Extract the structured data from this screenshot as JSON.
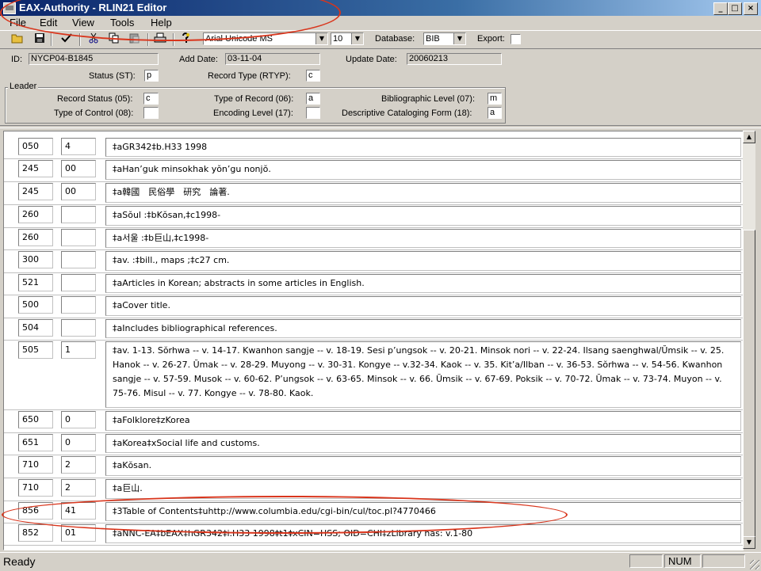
{
  "window": {
    "title": "EAX-Authority - RLIN21 Editor",
    "min_glyph": "_",
    "max_glyph": "□",
    "close_glyph": "×"
  },
  "menu": [
    "File",
    "Edit",
    "View",
    "Tools",
    "Help"
  ],
  "toolbar": {
    "icons": [
      "open-folder-icon",
      "save-icon",
      "checkmark-icon",
      "cut-icon",
      "copy-icon",
      "paste-icon",
      "print-icon",
      "help-icon"
    ],
    "font": "Arial Unicode MS",
    "font_size": "10",
    "database_label": "Database:",
    "database": "BIB",
    "export_label": "Export:",
    "export_checked": false
  },
  "header": {
    "id_label": "ID:",
    "id": "NYCP04-B1845",
    "add_date_label": "Add Date:",
    "add_date": "03-11-04",
    "update_date_label": "Update Date:",
    "update_date": "20060213",
    "status_label": "Status (ST):",
    "status": "p",
    "record_type_label": "Record Type (RTYP):",
    "record_type": "c"
  },
  "leader": {
    "group_label": "Leader",
    "record_status_label": "Record Status (05):",
    "record_status": "c",
    "type_of_record_label": "Type of Record (06):",
    "type_of_record": "a",
    "bib_level_label": "Bibliographic Level (07):",
    "bib_level": "m",
    "type_of_control_label": "Type of Control (08):",
    "type_of_control": "",
    "encoding_level_label": "Encoding Level (17):",
    "encoding_level": "",
    "desc_form_label": "Descriptive Cataloging Form (18):",
    "desc_form": "a"
  },
  "fields": [
    {
      "tag": "050",
      "ind": "4",
      "data": "‡aGR342‡b.H33 1998"
    },
    {
      "tag": "245",
      "ind": "00",
      "data": "‡aHan’guk minsokhak yŏn’gu nonjŏ."
    },
    {
      "tag": "245",
      "ind": "00",
      "data": "‡a韓國　民俗學　研究　論著."
    },
    {
      "tag": "260",
      "ind": "",
      "data": "‡aSŏul :‡bKŏsan,‡c1998-"
    },
    {
      "tag": "260",
      "ind": "",
      "data": "‡a서울 :‡b巨山,‡c1998-"
    },
    {
      "tag": "300",
      "ind": "",
      "data": "‡av. :‡bill., maps ;‡c27 cm."
    },
    {
      "tag": "521",
      "ind": "",
      "data": "‡aArticles in Korean; abstracts in some articles in English."
    },
    {
      "tag": "500",
      "ind": "",
      "data": "‡aCover title."
    },
    {
      "tag": "504",
      "ind": "",
      "data": "‡aIncludes bibliographical references."
    },
    {
      "tag": "505",
      "ind": "1",
      "data": "‡av. 1-13. Sŏrhwa -- v. 14-17. Kwanhon sangje -- v. 18-19. Sesi p’ungsok -- v. 20-21. Minsok nori -- v. 22-24. Ilsang saenghwal/Ŭmsik  -- v. 25. Hanok -- v. 26-27. Ŭmak -- v. 28-29. Muyong -- v. 30-31. Kongye -- v.32-34. Kaok -- v. 35. Kit’a/Ilban -- v. 36-53. Sŏrhwa -- v. 54-56. Kwanhon sangje -- v. 57-59. Musok -- v. 60-62. P’ungsok -- v. 63-65. Minsok -- v. 66. Ŭmsik -- v. 67-69. Poksik -- v. 70-72. Ŭmak -- v. 73-74. Muyon -- v. 75-76. Misul -- v. 77. Kongye -- v. 78-80. Kaok."
    },
    {
      "tag": "650",
      "ind": "0",
      "data": "‡aFolklore‡zKorea"
    },
    {
      "tag": "651",
      "ind": "0",
      "data": "‡aKorea‡xSocial life and customs."
    },
    {
      "tag": "710",
      "ind": "2",
      "data": "‡aKŏsan."
    },
    {
      "tag": "710",
      "ind": "2",
      "data": "‡a巨山."
    },
    {
      "tag": "856",
      "ind": "41",
      "data": "‡3Table of Contents‡uhttp://www.columbia.edu/cgi-bin/cul/toc.pl?4770466"
    },
    {
      "tag": "852",
      "ind": "01",
      "data": "‡aNNC-EA‡bEAX‡hGR342‡i.H33 1998‡t1‡xCIN=HSS; OID=CHI‡zLibrary has: v.1-80"
    }
  ],
  "scrollbar": {
    "up_glyph": "▲",
    "down_glyph": "▼"
  },
  "status": {
    "text": "Ready",
    "num": "NUM"
  },
  "colors": {
    "annotation": "#d9351c",
    "titlebar": "#0a246a",
    "chrome": "#d4d0c8"
  }
}
